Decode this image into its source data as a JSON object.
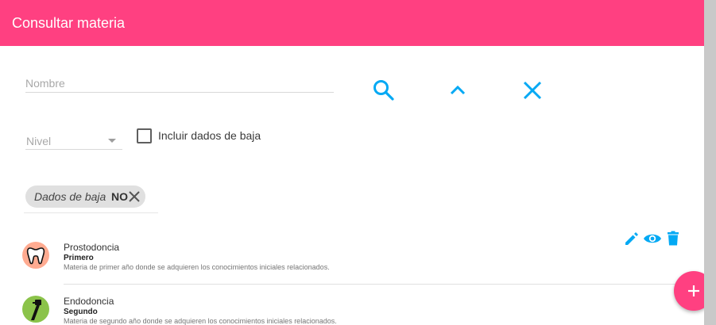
{
  "header": {
    "title": "Consultar materia"
  },
  "filters": {
    "name_placeholder": "Nombre",
    "level_placeholder": "Nivel",
    "include_inactive_label": "Incluir dados de baja",
    "include_inactive_checked": false,
    "search_icon": "search-icon",
    "collapse_icon": "chevron-up-icon",
    "clear_icon": "close-icon"
  },
  "chip": {
    "label": "Dados de baja",
    "value": "NO"
  },
  "items": [
    {
      "title": "Prostodoncia",
      "subtitle": "Primero",
      "description": "Materia de primer año donde se adquieren los conocimientos iniciales relacionados.",
      "avatar_icon": "tooth-icon",
      "avatar_color": "#ffab91"
    },
    {
      "title": "Endodoncia",
      "subtitle": "Segundo",
      "description": "Materia de segundo año donde se adquieren los conocimientos iniciales relacionados.",
      "avatar_icon": "dental-drill-icon",
      "avatar_color": "#8bc34a"
    }
  ],
  "actions": [
    "edit-icon",
    "view-icon",
    "delete-icon"
  ],
  "fab_icon": "plus-icon",
  "colors": {
    "accent": "#ff4081",
    "icon_blue": "#03a9f4"
  }
}
